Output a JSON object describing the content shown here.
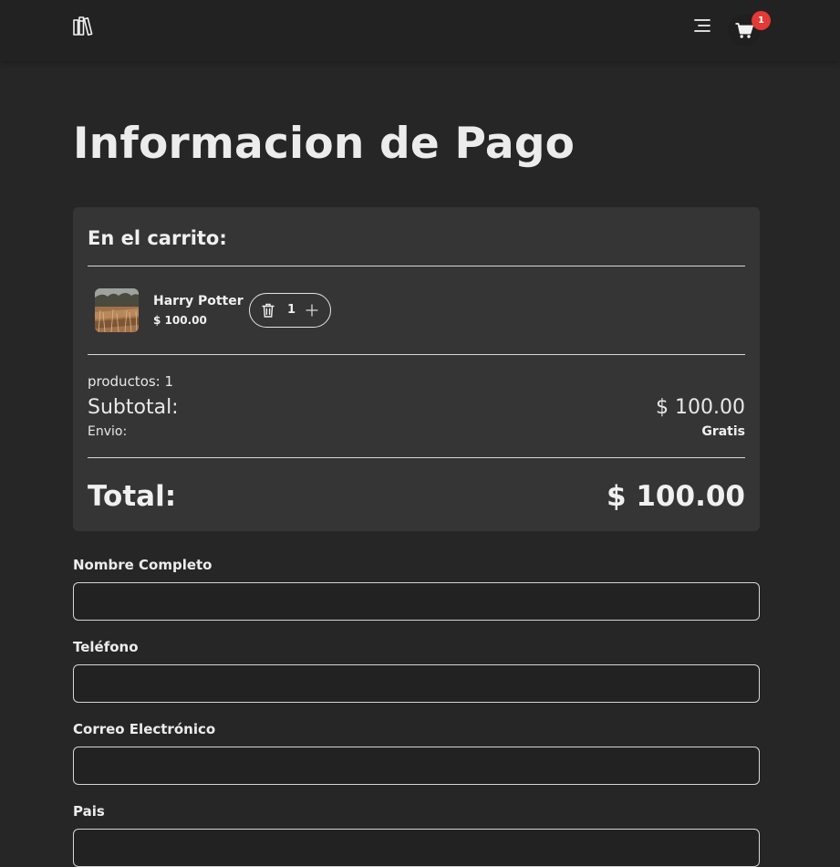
{
  "header": {
    "logo_icon": "books-icon",
    "menu_icon": "menu-icon",
    "cart_icon": "shopping-cart-icon",
    "cart_badge_count": "1",
    "badge_color": "#e53935"
  },
  "page": {
    "title": "Informacion de Pago"
  },
  "cart": {
    "heading": "En el carrito:",
    "items": [
      {
        "name": "Harry Potter",
        "price": "$ 100.00",
        "quantity": "1",
        "remove_icon": "trash-icon",
        "increase_icon": "plus-icon"
      }
    ],
    "count_line": "productos: 1",
    "subtotal_label": "Subtotal:",
    "subtotal_value": "$ 100.00",
    "shipping_label": "Envio:",
    "shipping_value": "Gratis",
    "total_label": "Total:",
    "total_value": "$ 100.00"
  },
  "form": {
    "fields": [
      {
        "label": "Nombre Completo",
        "value": "",
        "placeholder": ""
      },
      {
        "label": "Teléfono",
        "value": "",
        "placeholder": ""
      },
      {
        "label": "Correo Electrónico",
        "value": "",
        "placeholder": ""
      },
      {
        "label": "Pais",
        "value": "",
        "placeholder": ""
      }
    ]
  }
}
